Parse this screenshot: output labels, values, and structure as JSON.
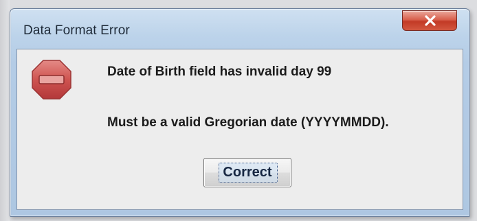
{
  "window": {
    "title": "Data Format Error",
    "close_icon": "close-icon"
  },
  "dialog": {
    "icon": "stop-sign-icon",
    "line1": "Date of Birth field has invalid day 99",
    "line2": "Must be a valid Gregorian date (YYYYMMDD).",
    "button_label": "Correct"
  },
  "colors": {
    "titlebar": "#bcd3ea",
    "close_button": "#d9604d",
    "client_background": "#ededed",
    "stop_icon": "#c0393b"
  }
}
